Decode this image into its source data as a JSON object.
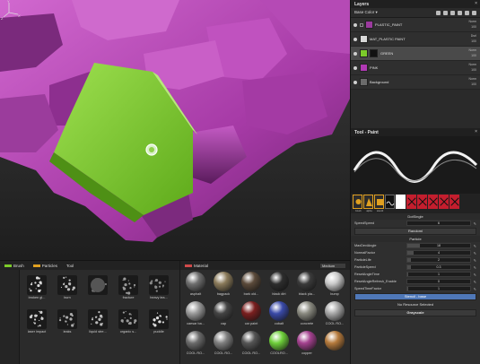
{
  "layers": {
    "title": "Layers",
    "channel": "Base Color",
    "rows": [
      {
        "name": "PLASTIC_PAINT",
        "blend": "Norm",
        "opacity": "100",
        "swatch": "#9b3a9e",
        "mask": "",
        "selected": false
      },
      {
        "name": "MAT_PLASTIC PAINT",
        "blend": "Dsrl",
        "opacity": "100",
        "swatch": "#d8d8d8",
        "mask": "",
        "selected": false
      },
      {
        "name": "GREEN",
        "blend": "Norm",
        "opacity": "100",
        "swatch": "#7ccb2a",
        "mask": "#111111",
        "selected": true
      },
      {
        "name": "PINK",
        "blend": "Norm",
        "opacity": "100",
        "swatch": "#b039b3",
        "mask": "",
        "selected": false
      },
      {
        "name": "Background",
        "blend": "Norm",
        "opacity": "100",
        "swatch": "#6b6b6b",
        "mask": "",
        "selected": false
      }
    ]
  },
  "tool": {
    "title": "Tool - Paint",
    "hardness_section": "DotSingle",
    "spacing_label": "SpeedSpeed",
    "spacing_value": "6",
    "randomize_label": "Randomi",
    "random_section": "Particle",
    "params": [
      {
        "name": "MaxDeviAngle",
        "value": "18",
        "fill": 0.2
      },
      {
        "name": "NormalFactor",
        "value": "4",
        "fill": 0.1
      },
      {
        "name": "ParticleLife",
        "value": "2",
        "fill": 0.05
      },
      {
        "name": "ParticleSpeed",
        "value": "0.3",
        "fill": 0.05
      },
      {
        "name": "ResetAngleTime",
        "value": "1",
        "fill": 0.02
      },
      {
        "name": "ResetAngleRefresh_Enable",
        "value": "0",
        "fill": 0.0
      },
      {
        "name": "SpeedTimeFactor",
        "value": "1",
        "fill": 0.02
      }
    ],
    "stencil_button": "Stencil - base",
    "no_resource": "No Resource Selected",
    "grayscale_button": "Grayscale",
    "slot_labels": [
      "brush",
      "alpha",
      "stencil",
      "",
      "",
      "",
      "",
      "",
      ""
    ]
  },
  "shelf": {
    "tabs": [
      {
        "label": "Brush",
        "color": "#7ccb2a"
      },
      {
        "label": "Particles",
        "color": "#e0a020"
      },
      {
        "label": "Tool",
        "color": ""
      }
    ],
    "brush_items": [
      "broken gl...",
      "burn",
      "",
      "fracture",
      "heavy lea...",
      "laser impact",
      "leaks",
      "liquid stre...",
      "organic s...",
      "puddle"
    ],
    "material_tab": "Material",
    "material_search": "Medium",
    "materials": [
      "asphalt",
      "bagpack",
      "bark old...",
      "black dirt",
      "black pla...",
      "bump",
      "caesar ba...",
      "cap",
      "car paint",
      "cobalt",
      "concrete",
      "COOL RO...",
      "COOL RO...",
      "COOL RO...",
      "COOL RO...",
      "COOLRO...",
      "copper",
      ""
    ]
  },
  "colors": {
    "selection": "#4a4a4a",
    "accent_blue": "#4f78b8",
    "pink_plastic": "#b13db0",
    "green_layer": "#7ccb2a"
  }
}
